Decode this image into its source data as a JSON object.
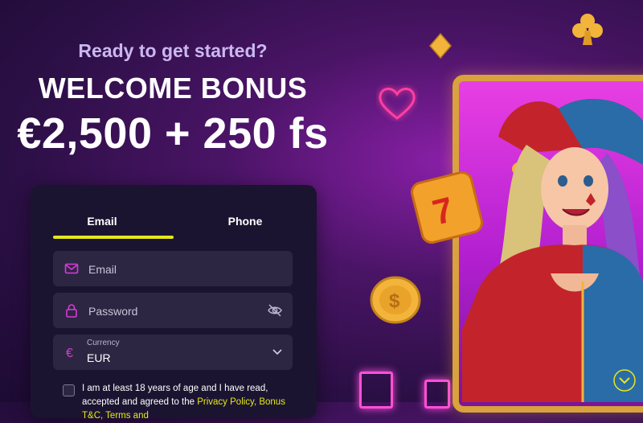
{
  "promo": {
    "kicker": "Ready to get started?",
    "headline": "WELCOME BONUS",
    "amount": "€2,500 + 250 fs"
  },
  "signup": {
    "tabs": [
      {
        "label": "Email",
        "active": true
      },
      {
        "label": "Phone",
        "active": false
      }
    ],
    "email": {
      "placeholder": "Email",
      "icon": "mail-icon"
    },
    "password": {
      "placeholder": "Password",
      "icon": "lock-icon",
      "toggle_icon": "eye-off-icon"
    },
    "currency": {
      "label": "Currency",
      "value": "EUR",
      "icon": "euro-icon"
    },
    "terms": {
      "text": "I am at least 18 years of age and I have read, accepted and agreed to the",
      "links": "Privacy Policy, Bonus T&C, Terms and"
    }
  },
  "colors": {
    "accent": "#e5e81b",
    "card_bg": "#1b1430",
    "field_bg": "#2d2643",
    "icon_magenta": "#d93bd6",
    "frame_gold": "#d9a23c"
  }
}
